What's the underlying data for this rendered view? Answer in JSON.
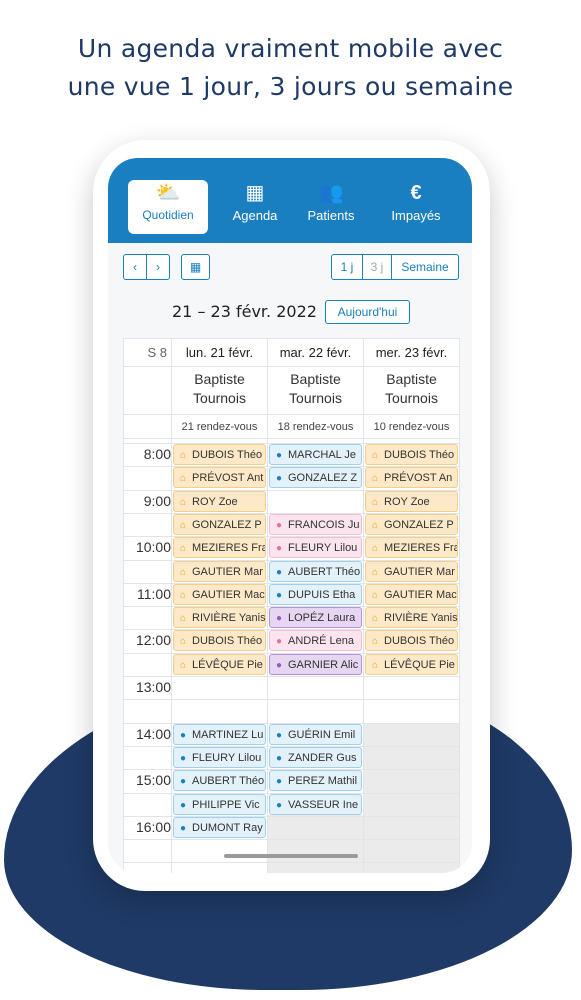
{
  "headline": {
    "line1": "Un agenda vraiment mobile avec",
    "line2": "une vue 1 jour, 3 jours ou semaine"
  },
  "nav": [
    {
      "label": "Quotidien",
      "icon": "sun-cloud-icon",
      "active": true
    },
    {
      "label": "Agenda",
      "icon": "calendar-icon",
      "active": false
    },
    {
      "label": "Patients",
      "icon": "users-icon",
      "active": false
    },
    {
      "label": "Impayés",
      "icon": "euro-icon",
      "active": false
    }
  ],
  "toolbar": {
    "prev": "‹",
    "next": "›",
    "view_1j": "1 j",
    "view_3j": "3 j",
    "view_week": "Semaine",
    "date_range": "21 – 23 févr. 2022",
    "today": "Aujourd'hui"
  },
  "calendar": {
    "week": "S 8",
    "days": [
      {
        "label": "lun. 21 févr.",
        "practitioner_first": "Baptiste",
        "practitioner_last": "Tournois",
        "count": "21 rendez-vous"
      },
      {
        "label": "mar. 22 févr.",
        "practitioner_first": "Baptiste",
        "practitioner_last": "Tournois",
        "count": "18 rendez-vous"
      },
      {
        "label": "mer. 23 févr.",
        "practitioner_first": "Baptiste",
        "practitioner_last": "Tournois",
        "count": "10 rendez-vous"
      }
    ],
    "hours": [
      "8:00",
      "9:00",
      "10:00",
      "11:00",
      "12:00",
      "13:00",
      "14:00",
      "15:00",
      "16:00"
    ],
    "appointments": {
      "day1": [
        {
          "name": "DUBOIS Théo",
          "kind": "home"
        },
        {
          "name": "PRÉVOST Ant",
          "kind": "home"
        },
        {
          "name": "ROY Zoe",
          "kind": "home"
        },
        {
          "name": "GONZALEZ P",
          "kind": "home"
        },
        {
          "name": "MEZIERES Fra",
          "kind": "home"
        },
        {
          "name": "GAUTIER Mar",
          "kind": "home"
        },
        {
          "name": "GAUTIER Mac",
          "kind": "home"
        },
        {
          "name": "RIVIÈRE Yanis",
          "kind": "home"
        },
        {
          "name": "DUBOIS Théo",
          "kind": "home"
        },
        {
          "name": "LÉVÊQUE Pie",
          "kind": "home"
        },
        {
          "name": "MARTINEZ Lu",
          "kind": "office"
        },
        {
          "name": "FLEURY Lilou",
          "kind": "office"
        },
        {
          "name": "AUBERT Théo",
          "kind": "office"
        },
        {
          "name": "PHILIPPE Vic",
          "kind": "office"
        },
        {
          "name": "DUMONT Ray",
          "kind": "office"
        }
      ],
      "day2": [
        {
          "name": "MARCHAL Je",
          "kind": "office"
        },
        {
          "name": "GONZALEZ Z",
          "kind": "office"
        },
        {
          "name": "FRANCOIS Ju",
          "kind": "pink"
        },
        {
          "name": "FLEURY Lilou",
          "kind": "pink"
        },
        {
          "name": "AUBERT Théo",
          "kind": "office"
        },
        {
          "name": "DUPUIS Etha",
          "kind": "office"
        },
        {
          "name": "LOPÉZ Laura",
          "kind": "purple"
        },
        {
          "name": "ANDRÉ Lena",
          "kind": "pink"
        },
        {
          "name": "GARNIER Alic",
          "kind": "purple"
        },
        {
          "name": "GUÉRIN Emil",
          "kind": "office"
        },
        {
          "name": "ZANDER Gus",
          "kind": "office"
        },
        {
          "name": "PEREZ Mathil",
          "kind": "office"
        },
        {
          "name": "VASSEUR Ine",
          "kind": "office"
        }
      ],
      "day3": [
        {
          "name": "DUBOIS Théo",
          "kind": "home"
        },
        {
          "name": "PRÉVOST An",
          "kind": "home"
        },
        {
          "name": "ROY Zoe",
          "kind": "home"
        },
        {
          "name": "GONZALEZ P",
          "kind": "home"
        },
        {
          "name": "MEZIERES Fra",
          "kind": "home"
        },
        {
          "name": "GAUTIER Mar",
          "kind": "home"
        },
        {
          "name": "GAUTIER Mac",
          "kind": "home"
        },
        {
          "name": "RIVIÈRE Yanis",
          "kind": "home"
        },
        {
          "name": "DUBOIS Théo",
          "kind": "home"
        },
        {
          "name": "LÉVÊQUE Pie",
          "kind": "home"
        }
      ]
    }
  },
  "colors": {
    "primary": "#1a7fc0",
    "headline": "#1f3a66",
    "home_bg": "#fde9c7",
    "office_bg": "#e2f1fa",
    "pink_bg": "#fbe4ee",
    "purple_bg": "#e6d6f2"
  }
}
